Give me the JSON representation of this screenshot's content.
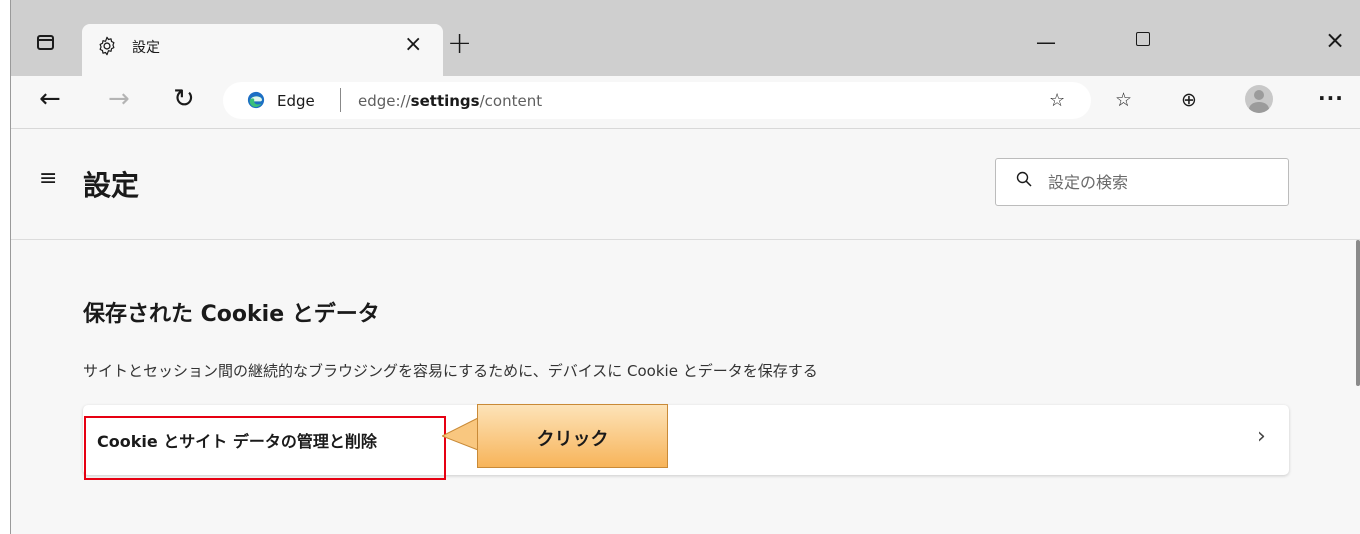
{
  "tab": {
    "title": "設定"
  },
  "toolbar": {
    "site": "Edge",
    "url_prefix": "edge://",
    "url_bold": "settings",
    "url_suffix": "/content"
  },
  "header": {
    "title": "設定",
    "search_placeholder": "設定の検索"
  },
  "section": {
    "title": "保存された Cookie とデータ",
    "description": "サイトとセッション間の継続的なブラウジングを容易にするために、デバイスに Cookie とデータを保存する",
    "items": [
      {
        "label": "Cookie とサイト データの管理と削除"
      }
    ]
  },
  "annotation": {
    "callout": "クリック",
    "highlight_color": "#e60012"
  },
  "colors": {
    "tabstrip": "#cfcfcf",
    "page_bg": "#f7f7f7",
    "edge_blue": "#0c59a4",
    "edge_green": "#3bbf7a"
  }
}
